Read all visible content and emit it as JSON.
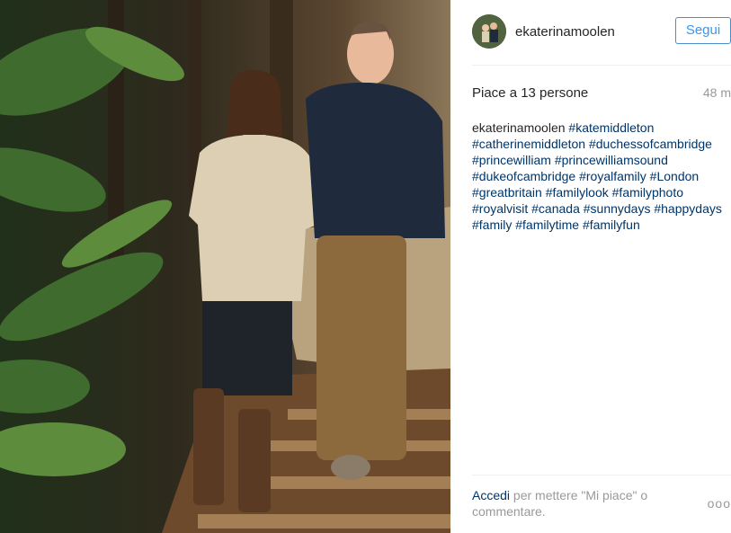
{
  "post": {
    "username": "ekaterinamoolen",
    "follow_label": "Segui",
    "likes_text": "Piace a 13 persone",
    "timestamp": "48 m",
    "caption_user": "ekaterinamoolen",
    "hashtags": [
      "#katemiddleton",
      "#catherinemiddleton",
      "#duchessofcambridge",
      "#princewilliam",
      "#princewilliamsound",
      "#dukeofcambridge",
      "#royalfamily",
      "#London",
      "#greatbritain",
      "#familylook",
      "#familyphoto",
      "#royalvisit",
      "#canada",
      "#sunnydays",
      "#happydays",
      "#family",
      "#familytime",
      "#familyfun"
    ],
    "login_link": "Accedi",
    "login_text": " per mettere \"Mi piace\" o commentare.",
    "more_label": "ooo"
  }
}
